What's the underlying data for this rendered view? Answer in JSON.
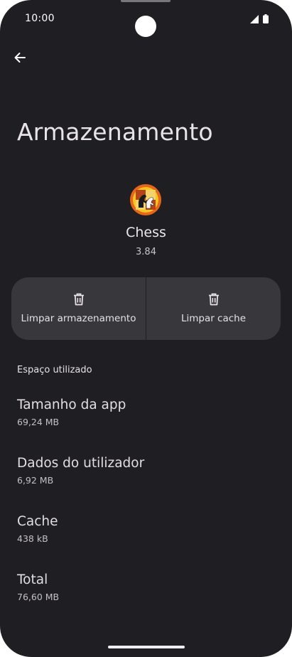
{
  "status_bar": {
    "time": "10:00"
  },
  "header": {
    "title": "Armazenamento"
  },
  "app": {
    "name": "Chess",
    "version": "3.84"
  },
  "actions": {
    "clear_storage": "Limpar armazenamento",
    "clear_cache": "Limpar cache"
  },
  "section": {
    "title": "Espaço utilizado"
  },
  "usage": [
    {
      "label": "Tamanho da app",
      "value": "69,24 MB"
    },
    {
      "label": "Dados do utilizador",
      "value": "6,92 MB"
    },
    {
      "label": "Cache",
      "value": "438 kB"
    },
    {
      "label": "Total",
      "value": "76,60 MB"
    }
  ],
  "colors": {
    "background": "#1f1f23",
    "card": "#38373c",
    "text": "#e6e1e6",
    "icon_orange": "#e8661a",
    "icon_yellow": "#f6c61c"
  },
  "icons": {
    "back": "arrow-back-icon",
    "trash": "delete-icon",
    "signal": "signal-icon",
    "battery": "battery-icon"
  }
}
